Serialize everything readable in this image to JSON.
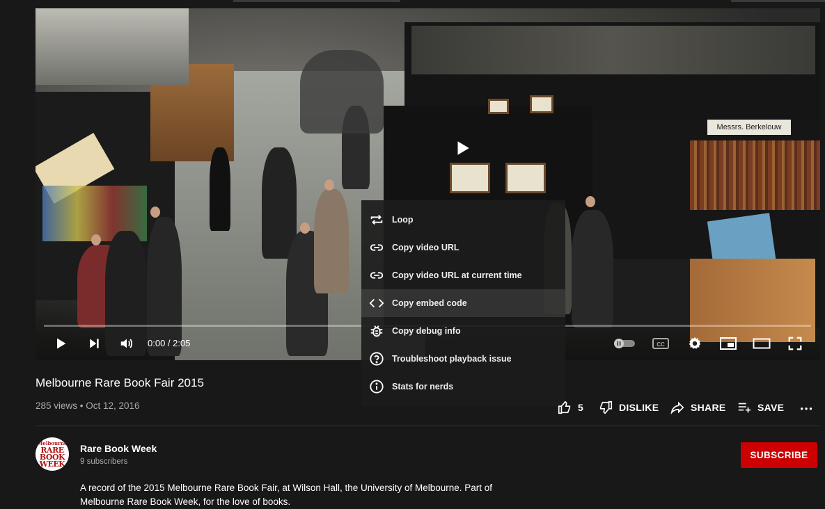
{
  "video": {
    "title": "Melbourne Rare Book Fair 2015",
    "time_display": "0:00 / 2:05",
    "progress": 0,
    "scene_banner": "Messrs. Berkelouw"
  },
  "context_menu": {
    "items": [
      {
        "label": "Loop",
        "icon": "loop-icon"
      },
      {
        "label": "Copy video URL",
        "icon": "link-icon"
      },
      {
        "label": "Copy video URL at current time",
        "icon": "link-icon"
      },
      {
        "label": "Copy embed code",
        "icon": "code-icon"
      },
      {
        "label": "Copy debug info",
        "icon": "bug-icon"
      },
      {
        "label": "Troubleshoot playback issue",
        "icon": "help-icon"
      },
      {
        "label": "Stats for nerds",
        "icon": "info-icon"
      }
    ]
  },
  "meta": {
    "views_date": "285 views • Oct 12, 2016"
  },
  "actions": {
    "like_count": "5",
    "dislike_label": "DISLIKE",
    "share_label": "SHARE",
    "save_label": "SAVE"
  },
  "channel": {
    "name": "Rare Book Week",
    "subscribers": "9 subscribers",
    "avatar_text_top": "Melbourne",
    "avatar_text_1": "RARE",
    "avatar_text_2": "BOOK",
    "avatar_text_3": "WEEK"
  },
  "subscribe_label": "SUBSCRIBE",
  "description": "A record of the 2015 Melbourne Rare Book Fair, at Wilson Hall, the University of Melbourne. Part of Melbourne Rare Book Week, for the love of books.",
  "colors": {
    "background": "#181818",
    "subscribe": "#cc0000",
    "secondary_text": "#aaaaaa"
  }
}
